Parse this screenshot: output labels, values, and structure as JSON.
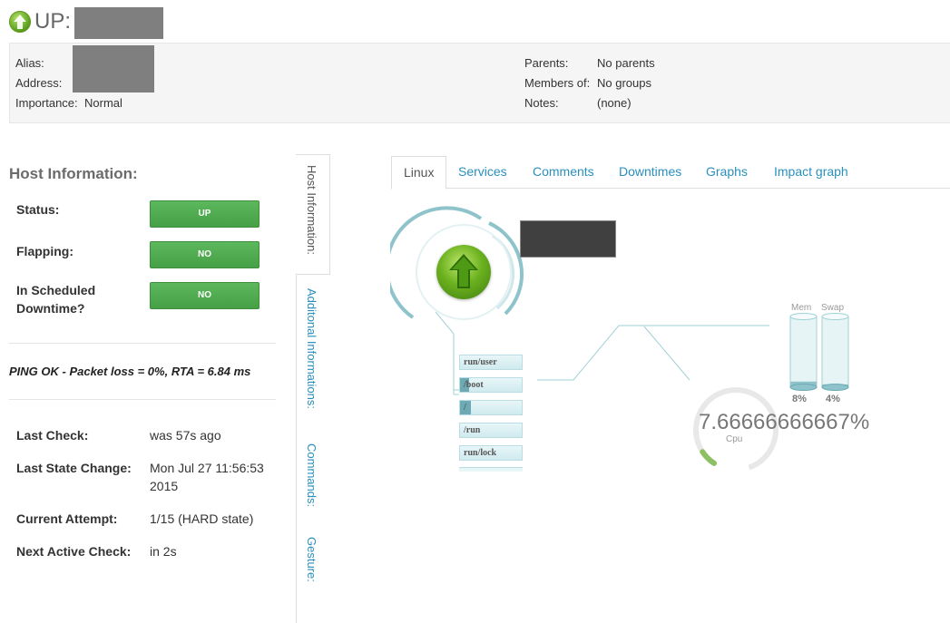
{
  "header": {
    "state_prefix": "UP:",
    "details_left": [
      {
        "label": "Alias:",
        "value": ""
      },
      {
        "label": "Address:",
        "value": ""
      },
      {
        "label": "Importance:",
        "value": "Normal"
      }
    ],
    "details_right": [
      {
        "label": "Parents:",
        "value": "No parents"
      },
      {
        "label": "Members of:",
        "value": "No groups"
      },
      {
        "label": "Notes:",
        "value": "(none)"
      }
    ]
  },
  "host_info": {
    "title": "Host Information:",
    "status_label": "Status:",
    "status_value": "UP",
    "flapping_label": "Flapping:",
    "flapping_value": "NO",
    "downtime_label_line1": "In Scheduled",
    "downtime_label_line2": "Downtime?",
    "downtime_value": "NO",
    "plugin_output": "PING OK - Packet loss = 0%, RTA = 6.84 ms",
    "last_check_label": "Last Check:",
    "last_check_value": "was 57s ago",
    "last_state_change_label": "Last State Change:",
    "last_state_change_line1": "Mon Jul 27 11:56:53",
    "last_state_change_line2": "2015",
    "current_attempt_label": "Current Attempt:",
    "current_attempt_value": "1/15 (HARD state)",
    "next_check_label": "Next Active Check:",
    "next_check_value": "in 2s"
  },
  "vertical_tabs": [
    {
      "label": "Host Information:",
      "active": true
    },
    {
      "label": "Additonal Informations:",
      "active": false
    },
    {
      "label": "Commands:",
      "active": false
    },
    {
      "label": "Gesture:",
      "active": false
    }
  ],
  "tabs": [
    {
      "label": "Linux",
      "active": true
    },
    {
      "label": "Services"
    },
    {
      "label": "Comments"
    },
    {
      "label": "Downtimes"
    },
    {
      "label": "Graphs"
    },
    {
      "label": "Impact graph"
    }
  ],
  "graph": {
    "filesystems": [
      {
        "label": "run/user",
        "fill": 0
      },
      {
        "label": "/boot",
        "fill": 0.15
      },
      {
        "label": "/",
        "fill": 0.17
      },
      {
        "label": "/run",
        "fill": 0
      },
      {
        "label": "run/lock",
        "fill": 0
      }
    ],
    "memory": {
      "label": "Mem",
      "value": "8%",
      "fill": 0.08
    },
    "swap": {
      "label": "Swap",
      "value": "4%",
      "fill": 0.04
    },
    "cpu": {
      "value": "7.66666666667%",
      "label": "Cpu",
      "fraction": 0.0767
    },
    "colors": {
      "ok_green": "#5cb85c",
      "accent_teal": "#7fbcc5",
      "link_blue": "#2a8fbd"
    }
  }
}
